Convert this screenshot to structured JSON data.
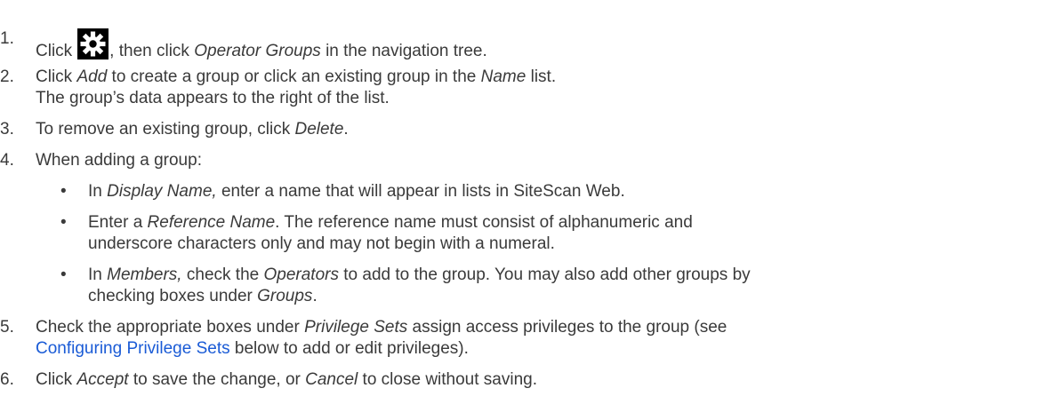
{
  "steps": [
    {
      "n": "1.",
      "click": "Click",
      "after_icon": ", then click ",
      "em": "Operator Groups",
      "tail": " in the navigation tree.",
      "icon": "gear-icon"
    },
    {
      "n": "2.",
      "pre": "Click ",
      "em1": "Add",
      "mid": " to create a group or click an existing group in the ",
      "em2": "Name",
      "tail": " list.",
      "line2": "The group’s data appears to the right of the list."
    },
    {
      "n": "3.",
      "pre": "To remove an existing group, click ",
      "em": "Delete",
      "tail": "."
    },
    {
      "n": "4.",
      "text": "When adding a group:"
    },
    {
      "n": "5.",
      "pre": "Check the appropriate boxes under ",
      "em": "Privilege Sets",
      "mid": " assign access privileges to the group (see",
      "link": "Configuring Privilege Sets",
      "tail": " below to add or edit privileges)."
    },
    {
      "n": "6.",
      "pre": "Click ",
      "em1": "Accept",
      "mid": " to save the change, or ",
      "em2": "Cancel",
      "tail": " to close without saving."
    }
  ],
  "bullets": [
    {
      "pre": "In ",
      "em": "Display Name,",
      "tail": " enter a name that will appear in lists in SiteScan Web."
    },
    {
      "pre": "Enter a ",
      "em": "Reference Name",
      "tail": ". The reference name must consist of alphanumeric and",
      "line2": "underscore characters only and may not begin with a numeral."
    },
    {
      "pre": "In ",
      "em1": "Members,",
      "mid": " check the ",
      "em2": "Operators",
      "tail": " to add to the group. You may also add other groups by",
      "line2_pre": "checking boxes under ",
      "line2_em": "Groups",
      "line2_tail": "."
    }
  ],
  "colors": {
    "text": "#3a3a3a",
    "link": "#1a5bd6",
    "icon_bg": "#000000"
  }
}
